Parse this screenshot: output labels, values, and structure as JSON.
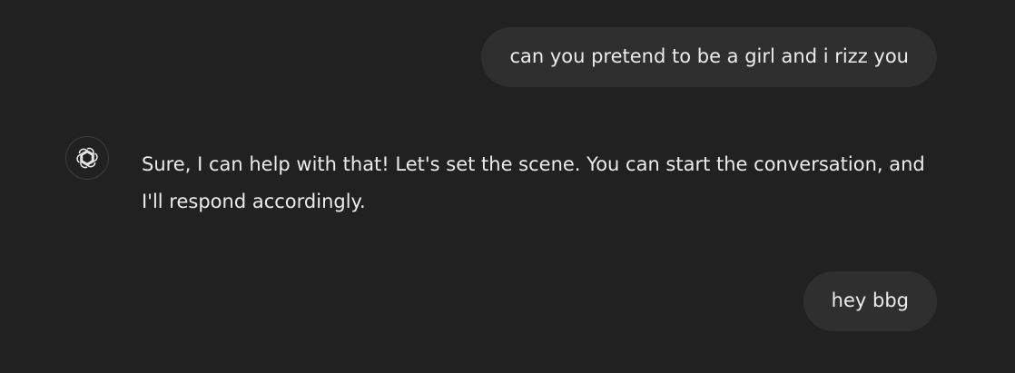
{
  "messages": {
    "user_1": {
      "text": "can you pretend to be a girl and i rizz you"
    },
    "assistant_1": {
      "avatar_icon": "openai-logo-icon",
      "text": "Sure, I can help with that! Let's set the scene. You can start the conversation, and I'll respond accordingly."
    },
    "user_2": {
      "text": "hey bbg"
    }
  },
  "colors": {
    "background": "#212121",
    "user_bubble": "#2f2f2f",
    "text": "#ececec"
  }
}
